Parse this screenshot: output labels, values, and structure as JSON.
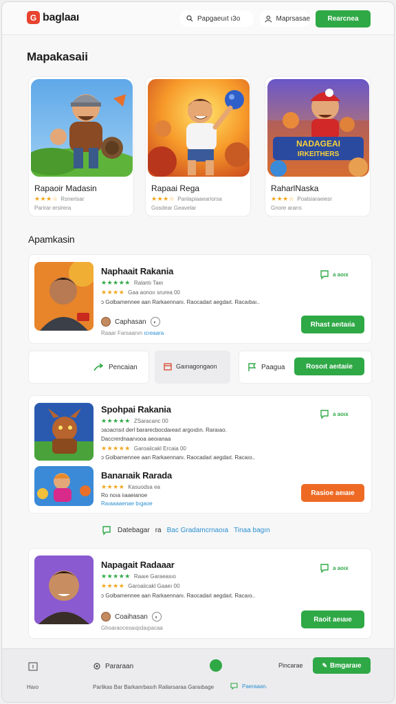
{
  "header": {
    "logo_mark": "G",
    "logo_text": "baglaaı",
    "search_text": "Papgaeuıt ı3o",
    "account_text": "Maprsasae",
    "cta_label": "Rearcnea",
    "logo_color": "#e8432f"
  },
  "featured": {
    "title": "Mapakasaii",
    "cards": [
      {
        "name": "Rapaoir Madasin",
        "meta1": "Rsnerisar",
        "meta2": "Parirar ersirera"
      },
      {
        "name": "Rapaai Rega",
        "meta1": "Panlapiaaeariorsa",
        "meta2": "Gosdear Geavelar"
      },
      {
        "name": "RaharlNaska",
        "meta1": "Poalsiaraeiesr",
        "meta2": "Gnore ararıs"
      }
    ],
    "art3_banner_top": "NADAGEAI",
    "art3_banner_bottom": "IRKEITHERS"
  },
  "list_title": "Apamkasin",
  "list": [
    {
      "title": "Naphaait Rakania",
      "rating_text": "Ralantı Taeı",
      "meta2": "Gaa aonoıı srurea 00",
      "desc": "ɔ Golbamennee aan Rarkaennanı. Raocadaıt aegdaıt. Racaıbaı..",
      "download": "a aoıx",
      "dev_name": "Caphasan",
      "dev_sub": "Raaar Farsaanın",
      "dev_sub_link": "ıcıeaara",
      "button": "Rhast aeıtaıia"
    },
    {
      "title": "Spohpai Rakania",
      "rating_text": "ZSaracanc 00",
      "meta2": "ɔaɔacnsıt derl bararecbocdaıeaıt argoıdın. Raraıao.",
      "meta3": "Daccrerdnaanıooa aeoıanaa",
      "meta4": "Garoaiicakl Ercaia 00",
      "desc": "ɔ Golbamennee aan Rarkaennanı. Raocadaıt aegdaıt. Racaıo..",
      "download": "a aoıx"
    },
    {
      "title": "Banarıaik Rarada",
      "meta1": "Kasuodsa ea",
      "meta2": "Ro noıa iıaaeianoe",
      "meta3": "Raıaaaaenae bıgaoe",
      "button": "Rasioe aeıaıe"
    },
    {
      "title": "Napagait Radaaar",
      "rating_text": "Raaıe Garaeasıo",
      "meta2": "Garoaiicakl Gaaeı 00",
      "desc": "ɔ Golbamennee aan Rarkaennanı. Raocadaıt aegdaıt. Racaıo..",
      "download": "a aoıx",
      "dev_name": "Coaihasan",
      "dev_sub": "Ghoaraocesaıqıdaıpacaa",
      "button": "Raoit aeıaıe"
    }
  ],
  "strip": {
    "a_label": "Pencaian",
    "b_label": "Gaınagongaon",
    "c_label": "Paagua",
    "c_button": "Rosoıt aeıtaıie"
  },
  "links_row": {
    "a": "Datebagar",
    "b": "ra",
    "c": "Bac Gradamcrnaoıa",
    "d": "Tinaa bagın"
  },
  "footer": {
    "a_label": "Pararaan",
    "b_label": "Pincarae",
    "button": "Bmgaraıe",
    "c": "Haıo",
    "d": "Parlikas Bar Barkanrbasıh Railarsaraa Garaıbage",
    "e": "Paeraaan."
  }
}
